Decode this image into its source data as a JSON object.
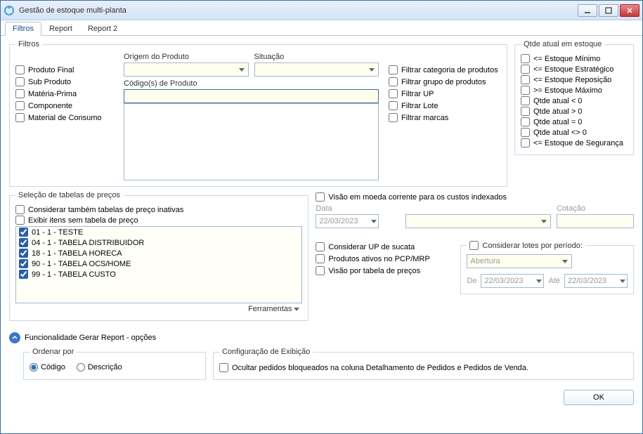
{
  "window": {
    "title": "Gestão de estoque multi-planta"
  },
  "tabs": [
    "Filtros",
    "Report",
    "Report 2"
  ],
  "filtros": {
    "legend": "Filtros",
    "product_types": [
      "Produto Final",
      "Sub Produto",
      "Matéria-Prima",
      "Componente",
      "Material de Consumo"
    ],
    "origem_label": "Origem do Produto",
    "situacao_label": "Situação",
    "codigos_label": "Código(s) de Produto",
    "filter_checks": [
      "Filtrar categoria de produtos",
      "Filtrar grupo de produtos",
      "Filtrar UP",
      "Filtrar Lote",
      "Filtrar marcas"
    ]
  },
  "qtde": {
    "legend": "Qtde atual em estoque",
    "items": [
      "<= Estoque Mínimo",
      "<= Estoque Estratégico",
      "<= Estoque Reposição",
      ">= Estoque Máximo",
      "Qtde atual < 0",
      "Qtde atual > 0",
      "Qtde atual = 0",
      "Qtde atual <> 0",
      "<= Estoque de Segurança"
    ]
  },
  "precos": {
    "legend": "Seleção de tabelas de preços",
    "consider_inativas": "Considerar também tabelas de preço inativas",
    "exibir_sem_tabela": "Exibir itens sem tabela de preço",
    "tables": [
      "01 - 1 - TESTE",
      "04 - 1 - TABELA DISTRIBUIDOR",
      "18 - 1 - TABELA HORECA",
      "90 - 1 - TABELA OCS/HOME",
      "99 - 1 - TABELA CUSTO"
    ],
    "ferramentas": "Ferramentas"
  },
  "moeda": {
    "visao_moeda": "Visão em moeda corrente para os custos indexados",
    "data_label": "Data",
    "data_value": "22/03/2023",
    "cotacao_label": "Cotação"
  },
  "middle": {
    "sucata": "Considerar UP de sucata",
    "pcp": "Produtos ativos no PCP/MRP",
    "visao_tabela": "Visão por tabela de preços"
  },
  "lotes": {
    "legend": "Considerar lotes por período:",
    "abertura": "Abertura",
    "de": "De",
    "ate": "Até",
    "de_val": "22/03/2023",
    "ate_val": "22/03/2023"
  },
  "report_opts": {
    "header": "Funcionalidade Gerar Report - opções",
    "ordenar_legend": "Ordenar por",
    "codigo": "Código",
    "descricao": "Descrição",
    "config_legend": "Configuração de Exibição",
    "ocultar": "Ocultar pedidos bloqueados na coluna Detalhamento de Pedidos e Pedidos de Venda."
  },
  "ok_btn": "OK"
}
